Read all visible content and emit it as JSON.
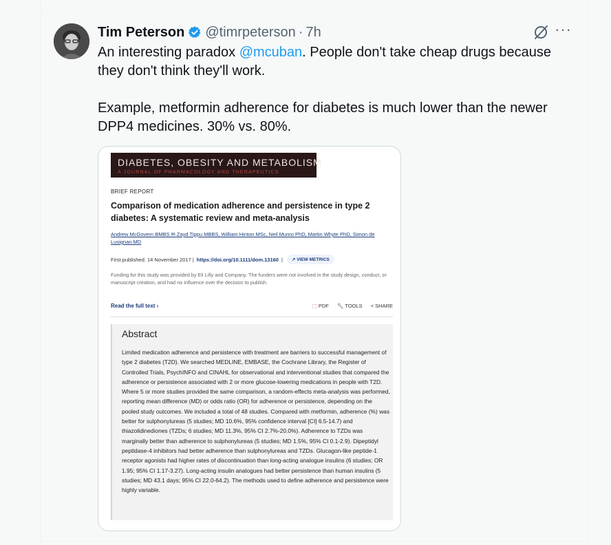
{
  "tweet": {
    "author_name": "Tim Peterson",
    "handle": "@timrpeterson",
    "separator": "·",
    "time": "7h",
    "more_label": "···",
    "text_p1_before": "An interesting paradox ",
    "mention": "@mcuban",
    "text_p1_after": ". People don't take cheap drugs because they don't think they'll work.",
    "text_p2": "Example, metformin adherence for diabetes is much lower than the newer DPP4 medicines. 30% vs. 80%."
  },
  "article": {
    "journal_title": "DIABETES, OBESITY AND METABOLISM",
    "journal_subtitle": "A JOURNAL OF PHARMACOLOGY AND THERAPEUTICS",
    "section": "BRIEF REPORT",
    "title": "Comparison of medication adherence and persistence in type 2 diabetes: A systematic review and meta-analysis",
    "authors": "Andrew McGovern BMBS ✉ Zayd Tippu MBBS, William Hinton MSc, Neil Munro PhD, Martin Whyte PhD, Simon de Lusignan MD",
    "published": "First published: 14 November 2017 |",
    "doi": "https://doi.org/10.1111/dom.13160",
    "doi_sep": "|",
    "view_metrics": "VIEW METRICS",
    "funding": "Funding for this study was provided by Eli Lilly and Company. The funders were not involved in the study design, conduct, or manuscript creation, and had no influence over the decision to publish.",
    "read_full": "Read the full text ›",
    "pdf": "PDF",
    "tools": "TOOLS",
    "share": "SHARE",
    "abstract_heading": "Abstract",
    "abstract_text": "Limited medication adherence and persistence with treatment are barriers to successful management of type 2 diabetes (T2D). We searched MEDLINE, EMBASE, the Cochrane Library, the Register of Controlled Trials, PsychINFO and CINAHL for observational and interventional studies that compared the adherence or persistence associated with 2 or more glucose-lowering medications in people with T2D. Where 5 or more studies provided the same comparison, a random-effects meta-analysis was performed, reporting mean difference (MD) or odds ratio (OR) for adherence or persistence, depending on the pooled study outcomes. We included a total of 48 studies. Compared with metformin, adherence (%) was better for sulphonylureas (5 studies; MD 10.6%, 95% confidence interval [CI] 6.5-14.7) and thiazolidinediones (TZDs; 6 studies; MD 11.3%, 95% CI 2.7%-20.0%). Adherence to TZDs was marginally better than adherence to sulphonylureas (5 studies; MD 1.5%, 95% CI 0.1-2.9). Dipeptidyl peptidase-4 inhibitors had better adherence than sulphonylureas and TZDs. Glucagon-like peptide-1 receptor agonists had higher rates of discontinuation than long-acting analogue insulins (6 studies; OR 1.95; 95% CI 1.17-3.27). Long-acting insulin analogues had better persistence than human insulins (5 studies; MD 43.1 days; 95% CI 22.0-64.2). The methods used to define adherence and persistence were highly variable."
  },
  "colors": {
    "link": "#1d9bf0",
    "verified": "#1d9bf0",
    "journal_banner": "#2a1718",
    "journal_accent": "#b8433e"
  },
  "icons": {
    "verified": "verified-badge-icon",
    "grok": "grok-icon",
    "more": "more-icon"
  }
}
